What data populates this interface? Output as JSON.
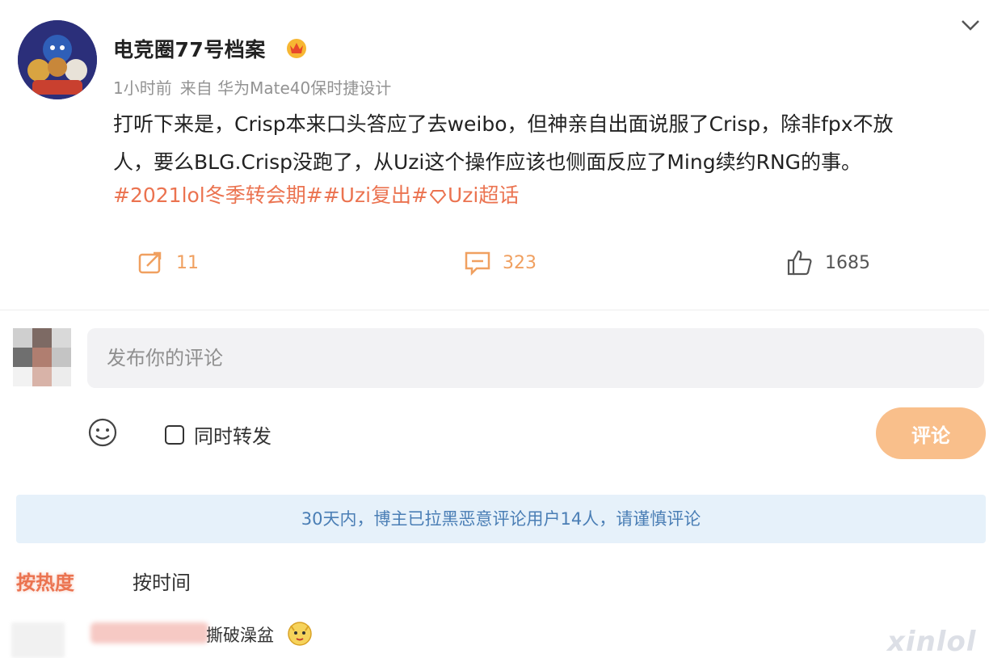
{
  "post": {
    "username": "电竞圈77号档案",
    "time": "1小时前",
    "source": "来自 华为Mate40保时捷设计",
    "text_line1": "打听下来是，Crisp本来口头答应了去weibo，但神亲自出面说服了Crisp，除非fpx不放",
    "text_line2": "人，要么BLG.Crisp没跑了，从Uzi这个操作应该也侧面反应了Ming续约RNG的事。",
    "tags": [
      "#2021lol冬季转会期#",
      "#Uzi复出#",
      "Uzi超话"
    ]
  },
  "actions": {
    "repost_count": "11",
    "comment_count": "323",
    "like_count": "1685"
  },
  "composer": {
    "placeholder": "发布你的评论",
    "repost_label": "同时转发",
    "submit_label": "评论"
  },
  "notice": "30天内，博主已拉黑恶意评论用户14人，请谨慎评论",
  "sort": {
    "hot_label": "按热度",
    "time_label": "按时间"
  },
  "comment_preview": {
    "text": "撕破澡盆"
  },
  "watermark": "xinlol",
  "colors": {
    "accent_orange": "#eb7350",
    "submit_bg": "#f9bf8b",
    "notice_bg": "#e6f1fa",
    "notice_text": "#4a7eb5"
  },
  "icons": [
    "crown-badge-icon",
    "chevron-down-icon",
    "repost-icon",
    "comment-icon",
    "like-icon",
    "emoji-icon",
    "gem-icon"
  ]
}
